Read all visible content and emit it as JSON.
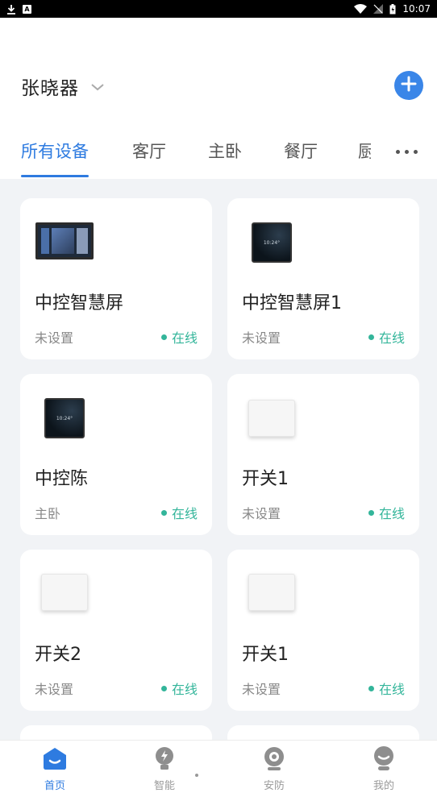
{
  "status_bar": {
    "time": "10:07",
    "app_icon_letter": "A"
  },
  "header": {
    "home_name": "张晓器",
    "add_label": "+"
  },
  "tabs": [
    {
      "label": "所有设备",
      "active": true
    },
    {
      "label": "客厅",
      "active": false
    },
    {
      "label": "主卧",
      "active": false
    },
    {
      "label": "餐厅",
      "active": false
    },
    {
      "label": "厨",
      "active": false
    }
  ],
  "devices": [
    {
      "name": "中控智慧屏",
      "room": "未设置",
      "status": "在线",
      "image": "wide-panel"
    },
    {
      "name": "中控智慧屏1",
      "room": "未设置",
      "status": "在线",
      "image": "square-panel"
    },
    {
      "name": "中控陈",
      "room": "主卧",
      "status": "在线",
      "image": "square-panel"
    },
    {
      "name": "开关1",
      "room": "未设置",
      "status": "在线",
      "image": "switch"
    },
    {
      "name": "开关2",
      "room": "未设置",
      "status": "在线",
      "image": "switch"
    },
    {
      "name": "开关1",
      "room": "未设置",
      "status": "在线",
      "image": "switch"
    }
  ],
  "panel_screen_text": "10:24°",
  "bottom_nav": [
    {
      "label": "首页",
      "icon": "home-icon",
      "active": true
    },
    {
      "label": "智能",
      "icon": "bulb-icon",
      "active": false
    },
    {
      "label": "安防",
      "icon": "camera-icon",
      "active": false
    },
    {
      "label": "我的",
      "icon": "profile-icon",
      "active": false
    }
  ],
  "colors": {
    "accent": "#2e7be0",
    "online": "#33b59a",
    "add_button": "#3a86e8"
  }
}
